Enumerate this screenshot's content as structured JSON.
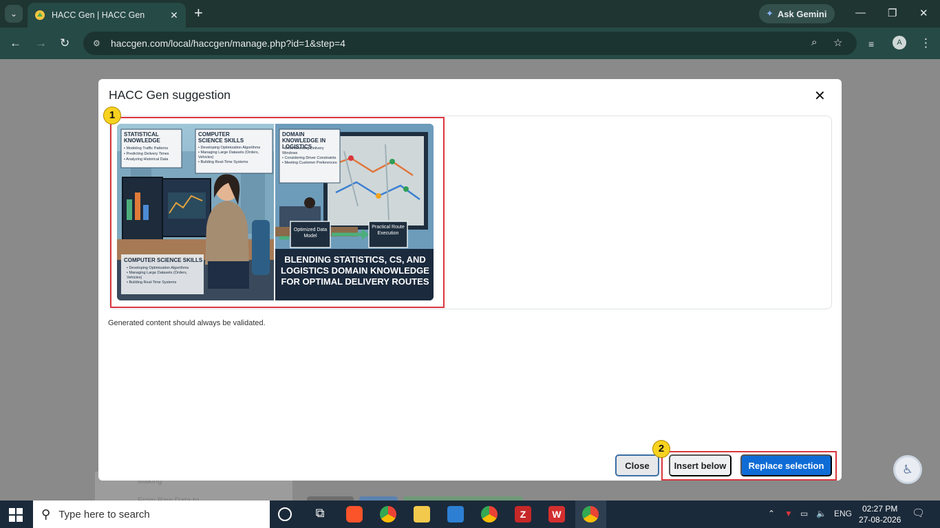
{
  "browser": {
    "tab_title": "HACC Gen | HACC Gen",
    "url": "haccgen.com/local/haccgen/manage.php?id=1&step=4",
    "ask_gemini": "Ask Gemini",
    "profile_initial": "A"
  },
  "background_page": {
    "sidebar_text_1": "Making",
    "sidebar_text_2": "From Raw Data to"
  },
  "modal": {
    "title": "HACC Gen suggestion",
    "badge_1": "1",
    "badge_2": "2",
    "disclaimer": "Generated content should always be validated.",
    "close_label": "Close",
    "insert_below_label": "Insert below",
    "replace_selection_label": "Replace selection"
  },
  "image": {
    "panel_1_title": "STATISTICAL KNOWLEDGE",
    "panel_1_items": [
      "Modeling Traffic Patterns",
      "Predicting Delivery Times",
      "Analyzing Historical Data"
    ],
    "panel_2_title": "COMPUTER SCIENCE SKILLS",
    "panel_2_items": [
      "Developing Optimization Algorithms",
      "Managing Large Datasets (Orders, Vehicles)",
      "Building Real-Time Systems"
    ],
    "panel_3_title": "DOMAIN KNOWLEDGE IN LOGISTICS",
    "panel_3_items": [
      "Understanding Delivery Windows",
      "Considering Driver Constraints",
      "Meeting Customer Preferences"
    ],
    "panel_4_title": "COMPUTER SCIENCE SKILLS",
    "panel_4_items": [
      "Developing Optimization Algorithms",
      "Managing Large Datasets (Orders, Vehicles)",
      "Building Real-Time Systems"
    ],
    "flow_box_1": "Optimized Data Model",
    "flow_box_2": "Practical Route Execution",
    "headline": "BLENDING STATISTICS, CS, AND LOGISTICS DOMAIN KNOWLEDGE FOR OPTIMAL DELIVERY ROUTES"
  },
  "taskbar": {
    "search_placeholder": "Type here to search",
    "language": "ENG",
    "time": "02:27 PM",
    "date": "27-08-2026"
  }
}
